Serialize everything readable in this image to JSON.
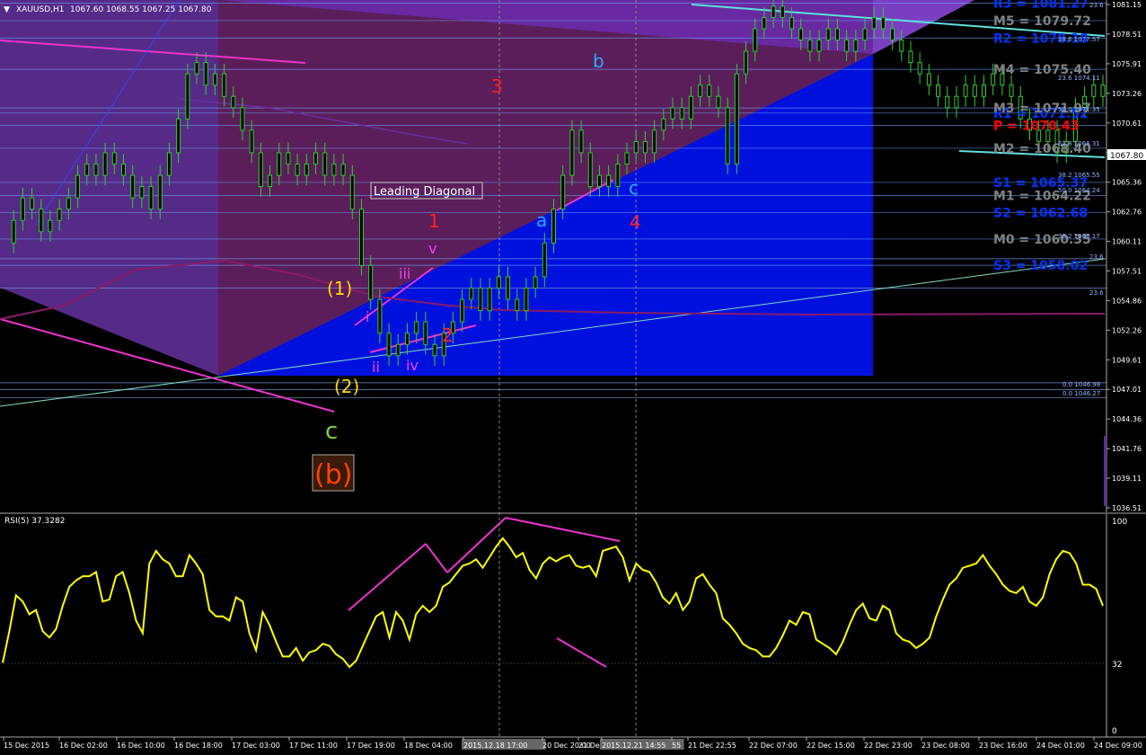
{
  "chart_data": [
    {
      "type": "candlestick",
      "symbol_label": "XAUUSD,H1",
      "ohlc_header": "1067.60 1068.55 1067.25 1067.80",
      "current_price_label": "1067.80",
      "ylim": [
        1036.51,
        1081.15
      ],
      "y_ticks": [
        "1081.15",
        "1078.51",
        "1075.91",
        "1073.26",
        "1070.61",
        "1067.96",
        "1065.36",
        "1062.76",
        "1060.11",
        "1057.51",
        "1054.86",
        "1052.26",
        "1049.61",
        "1047.01",
        "1044.36",
        "1041.76",
        "1039.11",
        "1036.51"
      ],
      "x_ticks": [
        "15 Dec 2015",
        "16 Dec 02:00",
        "16 Dec 10:00",
        "16 Dec 18:00",
        "17 Dec 03:00",
        "17 Dec 11:00",
        "17 Dec 19:00",
        "18 Dec 04:00",
        "2015.12.18 17:00",
        "20 Dec 20:00",
        "21 Dec",
        "2015.12.21 14:55",
        "55",
        "21 Dec 22:55",
        "22 Dec 07:00",
        "22 Dec 15:00",
        "22 Dec 23:00",
        "23 Dec 08:00",
        "23 Dec 16:00",
        "24 Dec 01:00",
        "24 Dec 09:00"
      ],
      "price_path": [
        1060,
        1062,
        1064,
        1063,
        1061,
        1062,
        1063,
        1064,
        1066,
        1067,
        1066,
        1068,
        1067,
        1066,
        1064,
        1065,
        1063,
        1066,
        1068,
        1071,
        1075,
        1076,
        1074,
        1075,
        1073,
        1072,
        1070,
        1068,
        1065,
        1066,
        1068,
        1067,
        1066,
        1067,
        1068,
        1066,
        1067,
        1066,
        1063,
        1058,
        1055,
        1052,
        1050,
        1051,
        1052,
        1053,
        1051,
        1050,
        1052,
        1053,
        1055,
        1056,
        1054,
        1056,
        1057,
        1055,
        1054,
        1056,
        1057,
        1060,
        1063,
        1066,
        1070,
        1068,
        1065,
        1066,
        1065,
        1067,
        1068,
        1069,
        1068,
        1070,
        1071,
        1072,
        1071,
        1073,
        1074,
        1073,
        1072,
        1067,
        1075,
        1077,
        1079,
        1080,
        1081,
        1080,
        1079,
        1078,
        1077,
        1078,
        1079,
        1078,
        1077,
        1078,
        1079,
        1080,
        1079,
        1078,
        1077,
        1076,
        1075,
        1074,
        1073,
        1072,
        1073,
        1074,
        1073,
        1074,
        1075,
        1074,
        1073,
        1071,
        1070,
        1069,
        1070,
        1068,
        1069,
        1072,
        1073,
        1074,
        1073
      ],
      "pivot_levels": [
        {
          "name": "R3",
          "label": "R3 = 1081.27",
          "value": 1081.27,
          "color": "#0033ff"
        },
        {
          "name": "M5",
          "label": "M5 = 1079.72",
          "value": 1079.72,
          "color": "#808080"
        },
        {
          "name": "R2",
          "label": "R2 = 1078.18",
          "value": 1078.18,
          "color": "#0033ff"
        },
        {
          "name": "M4",
          "label": "M4 = 1075.40",
          "value": 1075.4,
          "color": "#808080"
        },
        {
          "name": "R1",
          "label": "R1 = 1071.52",
          "value": 1071.52,
          "color": "#0033ff"
        },
        {
          "name": "M3",
          "label": "M3 = 1071.97",
          "value": 1071.97,
          "color": "#808080"
        },
        {
          "name": "P",
          "label": "P = 1070.43",
          "value": 1070.43,
          "color": "#ff0000"
        },
        {
          "name": "M2",
          "label": "M2 = 1068.40",
          "value": 1068.4,
          "color": "#808080"
        },
        {
          "name": "S1",
          "label": "S1 = 1065.37",
          "value": 1065.37,
          "color": "#0033ff"
        },
        {
          "name": "M1",
          "label": "M1 = 1064.22",
          "value": 1064.22,
          "color": "#808080"
        },
        {
          "name": "S2",
          "label": "S2 = 1062.68",
          "value": 1062.68,
          "color": "#0033ff"
        },
        {
          "name": "M0",
          "label": "M0 = 1060.35",
          "value": 1060.35,
          "color": "#808080"
        },
        {
          "name": "S3",
          "label": "S3 = 1058.02",
          "value": 1058.02,
          "color": "#0033ff"
        }
      ],
      "fib_labels": [
        "23.6",
        "38.6 1077.57",
        "23.6 1074.11",
        "50.0 1071.35",
        "61.8 1068.31",
        "38.2 1065.55",
        "50.0 1064.24",
        "38.2 1060.17",
        "23.6",
        "23.6",
        "0.0 1046.98",
        "0.0 1046.27"
      ],
      "annotations": [
        {
          "text": "Leading Diagonal",
          "color": "#ffffff"
        },
        {
          "text": "(1)",
          "color": "#ffd700"
        },
        {
          "text": "(2)",
          "color": "#ffd700"
        },
        {
          "text": "c",
          "color": "#7fd13b"
        },
        {
          "text": "(b)",
          "color": "#ff4500"
        },
        {
          "text": "i",
          "color": "#ee44ee"
        },
        {
          "text": "ii",
          "color": "#ee44ee"
        },
        {
          "text": "iii",
          "color": "#ee44ee"
        },
        {
          "text": "iv",
          "color": "#ee44ee"
        },
        {
          "text": "v",
          "color": "#ee44ee"
        },
        {
          "text": "1",
          "color": "#ff2222"
        },
        {
          "text": "2",
          "color": "#ff2222"
        },
        {
          "text": "3",
          "color": "#ff2222"
        },
        {
          "text": "4",
          "color": "#ff2222"
        },
        {
          "text": "a",
          "color": "#29aaff"
        },
        {
          "text": "b",
          "color": "#29aaff"
        },
        {
          "text": "c",
          "color": "#29aaff"
        }
      ]
    },
    {
      "type": "line",
      "title": "RSI(5) 37.3282",
      "ylim": [
        0,
        100
      ],
      "y_ticks": [
        "100",
        "32",
        "0"
      ],
      "values": [
        33,
        48,
        65,
        62,
        56,
        58,
        48,
        45,
        49,
        60,
        69,
        72,
        74,
        74,
        76,
        62,
        63,
        74,
        76,
        66,
        53,
        47,
        80,
        86,
        82,
        80,
        74,
        74,
        84,
        80,
        75,
        58,
        55,
        55,
        53,
        64,
        62,
        47,
        39,
        57,
        51,
        43,
        36,
        36,
        40,
        34,
        38,
        39,
        42,
        41,
        37,
        35,
        31,
        34,
        41,
        48,
        55,
        57,
        45,
        57,
        53,
        44,
        56,
        60,
        57,
        60,
        69,
        71,
        75,
        79,
        80,
        82,
        78,
        83,
        88,
        92,
        88,
        83,
        85,
        77,
        73,
        80,
        83,
        81,
        83,
        84,
        79,
        78,
        79,
        74,
        86,
        87,
        88,
        83,
        72,
        80,
        77,
        76,
        71,
        64,
        61,
        66,
        58,
        62,
        73,
        75,
        70,
        66,
        54,
        51,
        47,
        42,
        40,
        39,
        36,
        36,
        40,
        46,
        53,
        51,
        57,
        56,
        44,
        42,
        40,
        37,
        43,
        51,
        58,
        61,
        54,
        53,
        60,
        58,
        47,
        44,
        43,
        40,
        42,
        45,
        55,
        63,
        70,
        73,
        78,
        79,
        80,
        84,
        79,
        75,
        70,
        67,
        66,
        69,
        62,
        60,
        64,
        75,
        82,
        86,
        85,
        80,
        70,
        70,
        68,
        60
      ],
      "overbought_level": 32
    }
  ]
}
